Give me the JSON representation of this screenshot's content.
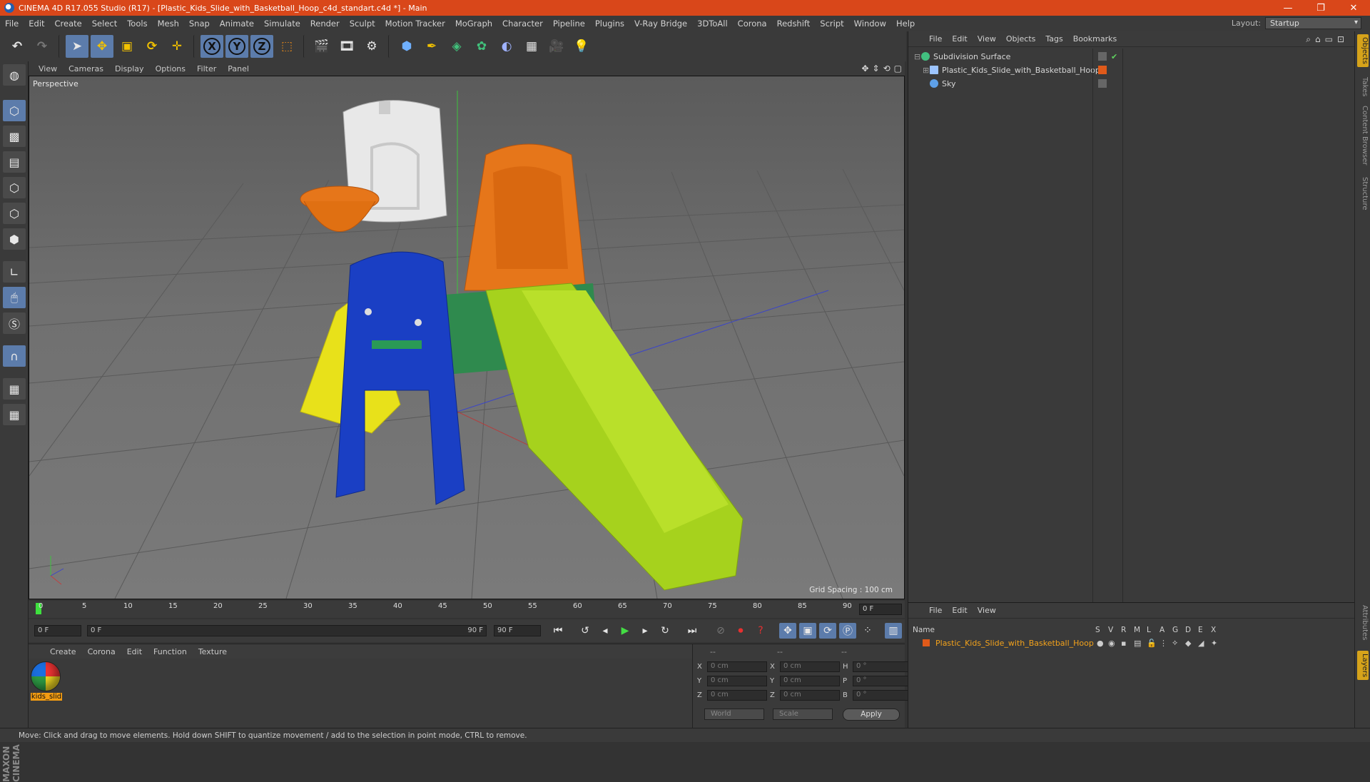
{
  "window": {
    "title": "CINEMA 4D R17.055 Studio (R17) - [Plastic_Kids_Slide_with_Basketball_Hoop_c4d_standart.c4d *] - Main",
    "controls": [
      "—",
      "❐",
      "✕"
    ]
  },
  "menubar": {
    "items": [
      "File",
      "Edit",
      "Create",
      "Select",
      "Tools",
      "Mesh",
      "Snap",
      "Animate",
      "Simulate",
      "Render",
      "Sculpt",
      "Motion Tracker",
      "MoGraph",
      "Character",
      "Pipeline",
      "Plugins",
      "V-Ray Bridge",
      "3DToAll",
      "Corona",
      "Redshift",
      "Script",
      "Window",
      "Help"
    ],
    "layout_label": "Layout:",
    "layout_value": "Startup"
  },
  "toolbar": {
    "axis_x": "X",
    "axis_y": "Y",
    "axis_z": "Z"
  },
  "viewport": {
    "menu": [
      "View",
      "Cameras",
      "Display",
      "Options",
      "Filter",
      "Panel"
    ],
    "label": "Perspective",
    "grid_spacing": "Grid Spacing : 100 cm"
  },
  "timeline": {
    "ticks": [
      "0",
      "5",
      "10",
      "15",
      "20",
      "25",
      "30",
      "35",
      "40",
      "45",
      "50",
      "55",
      "60",
      "65",
      "70",
      "75",
      "80",
      "85",
      "90"
    ],
    "current_frame": "0 F"
  },
  "playback": {
    "start": "0 F",
    "range_start": "0 F",
    "range_end": "90 F",
    "end": "90 F"
  },
  "materials": {
    "menu": [
      "Create",
      "Corona",
      "Edit",
      "Function",
      "Texture"
    ],
    "items": [
      {
        "name": "kids_slid"
      }
    ]
  },
  "coordinates": {
    "header": [
      "--",
      "--",
      "--"
    ],
    "rows": [
      {
        "a": "X",
        "av": "0 cm",
        "b": "X",
        "bv": "0 cm",
        "c": "H",
        "cv": "0 °"
      },
      {
        "a": "Y",
        "av": "0 cm",
        "b": "Y",
        "bv": "0 cm",
        "c": "P",
        "cv": "0 °"
      },
      {
        "a": "Z",
        "av": "0 cm",
        "b": "Z",
        "bv": "0 cm",
        "c": "B",
        "cv": "0 °"
      }
    ],
    "world": "World",
    "scale": "Scale",
    "apply": "Apply"
  },
  "objects": {
    "menu": [
      "File",
      "Edit",
      "View",
      "Objects",
      "Tags",
      "Bookmarks"
    ],
    "tree": [
      {
        "name": "Subdivision Surface",
        "icon_color": "#42c080"
      },
      {
        "name": "Plastic_Kids_Slide_with_Basketball_Hoop",
        "icon_color": "#9cc4ff"
      },
      {
        "name": "Sky",
        "icon_color": "#5ea0e8"
      }
    ]
  },
  "layers": {
    "menu": [
      "File",
      "Edit",
      "View"
    ],
    "columns": [
      "Name",
      "S",
      "V",
      "R",
      "M",
      "L",
      "A",
      "G",
      "D",
      "E",
      "X"
    ],
    "rows": [
      {
        "name": "Plastic_Kids_Slide_with_Basketball_Hoop",
        "color": "#e05a1a"
      }
    ]
  },
  "sidetabs": [
    "Objects",
    "Takes",
    "Content Browser",
    "Structure",
    "Attributes",
    "Layers"
  ],
  "status": "Move: Click and drag to move elements. Hold down SHIFT to quantize movement / add to the selection in point mode, CTRL to remove.",
  "brand": "MAXON CINEMA 4D",
  "colors": {
    "title_bar": "#d9471a",
    "accent": "#5c7cab",
    "selection": "#f39c12"
  }
}
